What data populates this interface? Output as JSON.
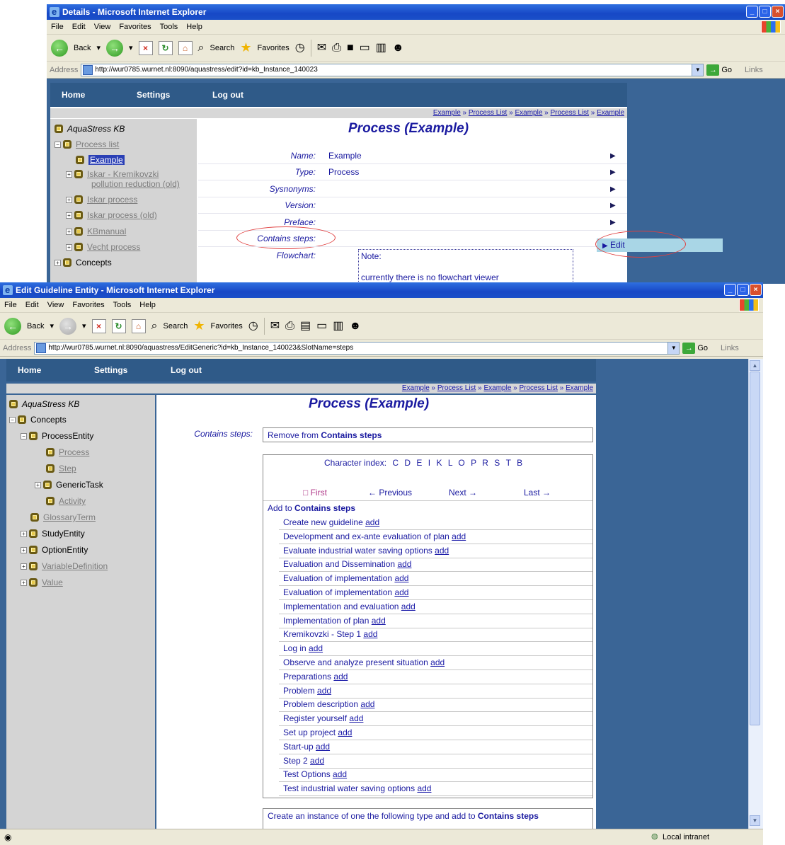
{
  "window1": {
    "title": "Details - Microsoft Internet Explorer",
    "menu": [
      "File",
      "Edit",
      "View",
      "Favorites",
      "Tools",
      "Help"
    ],
    "toolbar": {
      "back": "Back",
      "search": "Search",
      "favorites": "Favorites"
    },
    "address_label": "Address",
    "url": "http://wur0785.wurnet.nl:8090/aquastress/edit?id=kb_Instance_140023",
    "go": "Go",
    "links": "Links",
    "nav": {
      "home": "Home",
      "settings": "Settings",
      "logout": "Log out"
    },
    "breadcrumb": [
      "Example",
      "Process List",
      "Example",
      "Process List",
      "Example"
    ],
    "tree": {
      "root": "AquaStress KB",
      "process_list": "Process list",
      "example": "Example",
      "iskar_kremikovzki_1": "Iskar - Kremikovzki",
      "iskar_kremikovzki_2": "pollution reduction (old)",
      "iskar_process": "Iskar process",
      "iskar_process_old": "Iskar process (old)",
      "kbmanual": "KBmanual",
      "vecht_process": "Vecht process",
      "concepts": "Concepts"
    },
    "page_title": "Process (Example)",
    "fields": [
      {
        "label": "Name:",
        "value": "Example"
      },
      {
        "label": "Type:",
        "value": "Process"
      },
      {
        "label": "Sysnonyms:",
        "value": ""
      },
      {
        "label": "Version:",
        "value": ""
      },
      {
        "label": "Preface:",
        "value": ""
      },
      {
        "label": "Contains steps:",
        "value": ""
      },
      {
        "label": "Flowchart:",
        "value": ""
      }
    ],
    "edit_label": "Edit",
    "note_text": "Note:",
    "note_text2": "currently there is no flowchart viewer"
  },
  "window2": {
    "title": "Edit Guideline Entity - Microsoft Internet Explorer",
    "menu": [
      "File",
      "Edit",
      "View",
      "Favorites",
      "Tools",
      "Help"
    ],
    "toolbar": {
      "back": "Back",
      "search": "Search",
      "favorites": "Favorites"
    },
    "address_label": "Address",
    "url": "http://wur0785.wurnet.nl:8090/aquastress/EditGeneric?id=kb_Instance_140023&SlotName=steps",
    "go": "Go",
    "links": "Links",
    "nav": {
      "home": "Home",
      "settings": "Settings",
      "logout": "Log out"
    },
    "breadcrumb": [
      "Example",
      "Process List",
      "Example",
      "Process List",
      "Example"
    ],
    "tree": {
      "root": "AquaStress KB",
      "concepts": "Concepts",
      "process_entity": "ProcessEntity",
      "process": "Process",
      "step": "Step",
      "generic_task": "GenericTask",
      "activity": "Activity",
      "glossary_term": "GlossaryTerm",
      "study_entity": "StudyEntity",
      "option_entity": "OptionEntity",
      "variable_definition": "VariableDefinition",
      "value": "Value"
    },
    "page_title": "Process (Example)",
    "contains_steps_label": "Contains steps:",
    "remove_prefix": "Remove from ",
    "remove_bold": "Contains steps",
    "char_index_label": "Character index:",
    "char_index": [
      "C",
      "D",
      "E",
      "I",
      "K",
      "L",
      "O",
      "P",
      "R",
      "S",
      "T",
      "B"
    ],
    "pager": {
      "first": "First",
      "previous": "← Previous",
      "next": "Next →",
      "last": "Last →"
    },
    "add_to_prefix": "Add to ",
    "add_to_bold": "Contains steps",
    "add_label": "add",
    "steps": [
      "Create new guideline",
      "Development and ex-ante evaluation of plan",
      "Evaluate industrial water saving options",
      "Evaluation and Dissemination",
      "Evaluation of implementation",
      "Evaluation of implementation",
      "Implementation and evaluation",
      "Implementation of plan",
      "Kremikovzki - Step 1",
      "Log in",
      "Observe and analyze present situation",
      "Preparations",
      "Problem",
      "Problem description",
      "Register yourself",
      "Set up project",
      "Start-up",
      "Step 2",
      "Test Options",
      "Test industrial water saving options"
    ],
    "create_prefix": "Create an instance of one the following type and add to ",
    "create_bold": "Contains steps",
    "status": "Local intranet"
  }
}
